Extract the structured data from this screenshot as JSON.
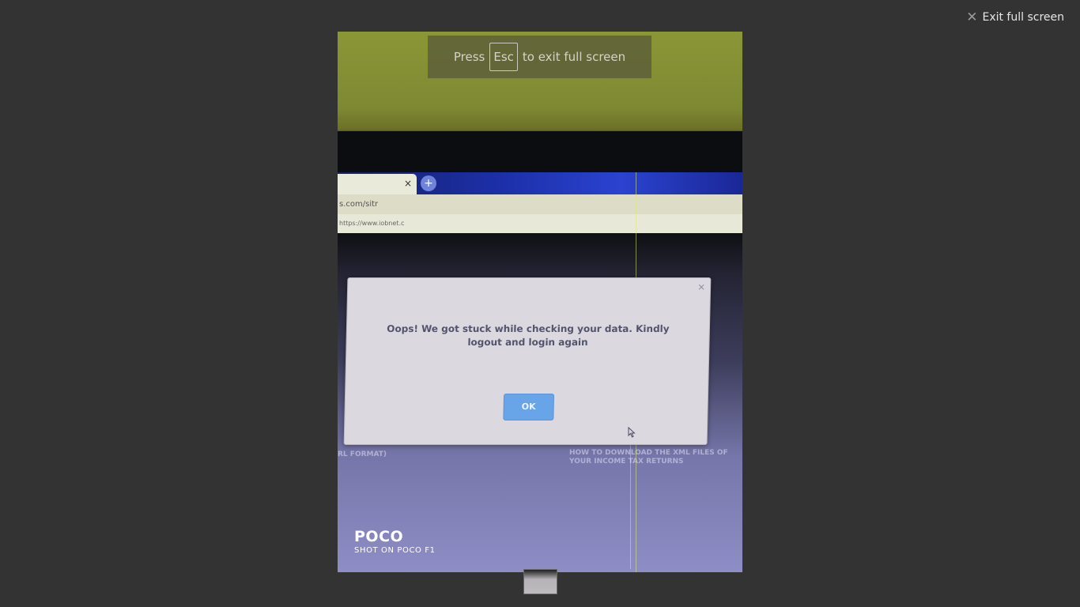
{
  "viewer": {
    "exit_fullscreen_label": "Exit full screen"
  },
  "fullscreen_notice": {
    "press": "Press",
    "key": "Esc",
    "rest": "to exit full screen"
  },
  "photo": {
    "browser": {
      "address_text": "s.com/sitr",
      "bookmark_text": "https://www.iobnet.c",
      "tab_close": "×",
      "new_tab": "+"
    },
    "dialog": {
      "close": "×",
      "message": "Oops! We got stuck while checking your data. Kindly logout and login again",
      "ok_label": "OK"
    },
    "page_fragments": {
      "left_heading": "RL FORMAT)",
      "right_heading": "HOW TO DOWNLOAD THE XML FILES OF YOUR INCOME TAX RETURNS"
    },
    "watermark": {
      "brand": "POCO",
      "shot_on": "SHOT ON POCO F1"
    }
  },
  "icons": {
    "close": "close-icon",
    "cursor": "mouse-cursor-icon"
  },
  "colors": {
    "background": "#333333",
    "ok_button": "#68a4e8",
    "dialog_bg": "#dcd8df"
  }
}
